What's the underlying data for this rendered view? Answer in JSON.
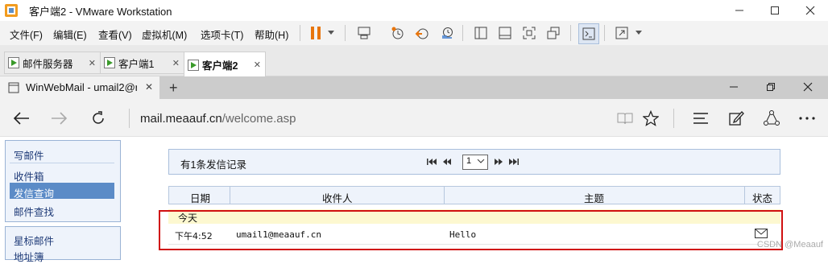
{
  "vmware": {
    "title": "客户端2 - VMware Workstation",
    "menu": [
      "文件(F)",
      "编辑(E)",
      "查看(V)",
      "虚拟机(M)",
      "选项卡(T)",
      "帮助(H)"
    ],
    "tabs": [
      {
        "label": "邮件服务器"
      },
      {
        "label": "客户端1"
      },
      {
        "label": "客户端2"
      }
    ]
  },
  "browser": {
    "tab_title": "WinWebMail - umail2@r",
    "url_domain": "mail.meaauf.cn",
    "url_path": "/welcome.asp"
  },
  "sidebar": {
    "compose": "写邮件",
    "items": [
      "收件箱",
      "发信查询",
      "邮件查找"
    ],
    "selected": "发信查询",
    "section2": [
      "星标邮件",
      "地址簿"
    ]
  },
  "main": {
    "record_count": "有1条发信记录",
    "page_select": "1",
    "columns": [
      "日期",
      "收件人",
      "主题",
      "状态"
    ],
    "group_label": "今天",
    "rows": [
      {
        "date": "下午4:52",
        "recipient": "umail1@meaauf.cn",
        "subject": "Hello",
        "status": "envelope-icon"
      }
    ]
  },
  "watermark": "CSDN @Meaauf",
  "colors": {
    "accent": "#5b8bc7",
    "highlight_border": "#d01010",
    "pause_orange": "#e8750c"
  }
}
